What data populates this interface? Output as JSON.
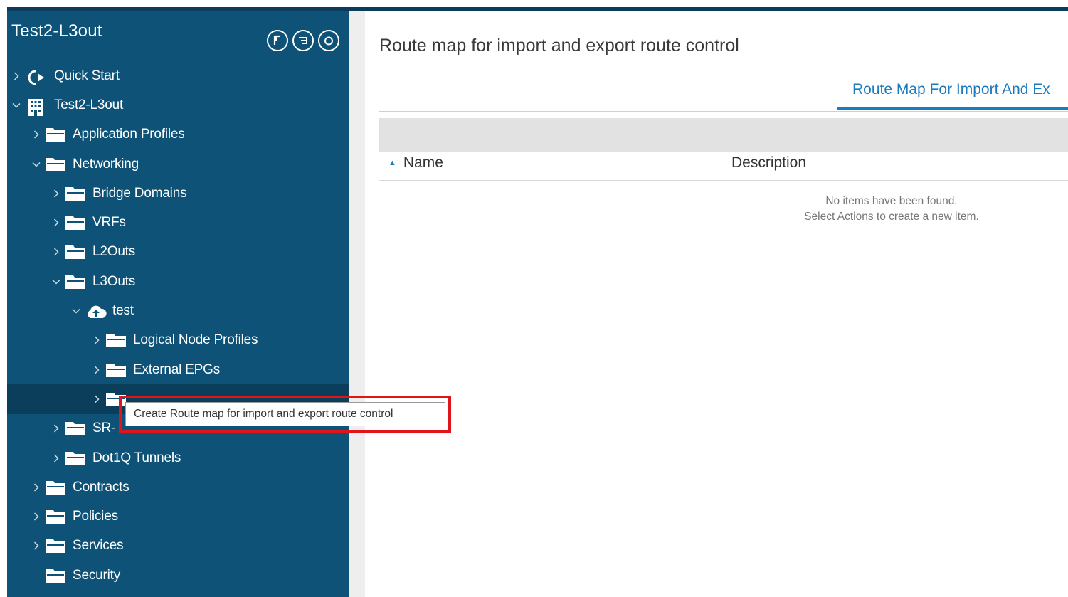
{
  "sidebar": {
    "title": "Test2-L3out",
    "tools": [
      "pin-icon",
      "list-icon",
      "refresh-icon"
    ],
    "items": [
      {
        "label": "Quick Start",
        "icon": "quickstart-icon",
        "expanded": false,
        "level": 0
      },
      {
        "label": "Test2-L3out",
        "icon": "tenant-icon",
        "expanded": true,
        "level": 0
      },
      {
        "label": "Application Profiles",
        "icon": "folder-icon",
        "expanded": false,
        "level": 1
      },
      {
        "label": "Networking",
        "icon": "folder-icon",
        "expanded": true,
        "level": 1
      },
      {
        "label": "Bridge Domains",
        "icon": "folder-icon",
        "expanded": false,
        "level": 2
      },
      {
        "label": "VRFs",
        "icon": "folder-icon",
        "expanded": false,
        "level": 2
      },
      {
        "label": "L2Outs",
        "icon": "folder-icon",
        "expanded": false,
        "level": 2
      },
      {
        "label": "L3Outs",
        "icon": "folder-icon",
        "expanded": true,
        "level": 2
      },
      {
        "label": "test",
        "icon": "cloud-icon",
        "expanded": true,
        "level": 3
      },
      {
        "label": "Logical Node Profiles",
        "icon": "folder-icon",
        "expanded": false,
        "level": 4
      },
      {
        "label": "External EPGs",
        "icon": "folder-icon",
        "expanded": false,
        "level": 4
      },
      {
        "label": "",
        "icon": "folder-icon",
        "expanded": false,
        "level": 4,
        "selected": true
      },
      {
        "label": "SR-",
        "icon": "folder-icon",
        "expanded": false,
        "level": 2
      },
      {
        "label": "Dot1Q Tunnels",
        "icon": "folder-icon",
        "expanded": false,
        "level": 2
      },
      {
        "label": "Contracts",
        "icon": "folder-icon",
        "expanded": false,
        "level": 1
      },
      {
        "label": "Policies",
        "icon": "folder-icon",
        "expanded": false,
        "level": 1
      },
      {
        "label": "Services",
        "icon": "folder-icon",
        "expanded": false,
        "level": 1
      },
      {
        "label": "Security",
        "icon": "folder-icon",
        "expanded": false,
        "level": 1
      }
    ]
  },
  "main": {
    "title": "Route map for import and export route control",
    "tab_label": "Route Map For Import And Ex",
    "columns": [
      "Name",
      "Description"
    ],
    "empty_line1": "No items have been found.",
    "empty_line2": "Select Actions to create a new item."
  },
  "tooltip": {
    "text": "Create Route map for import and export route control"
  },
  "colors": {
    "sidebar_bg": "#0e5377",
    "accent": "#1a7bbf",
    "highlight_border": "#e0151b"
  }
}
